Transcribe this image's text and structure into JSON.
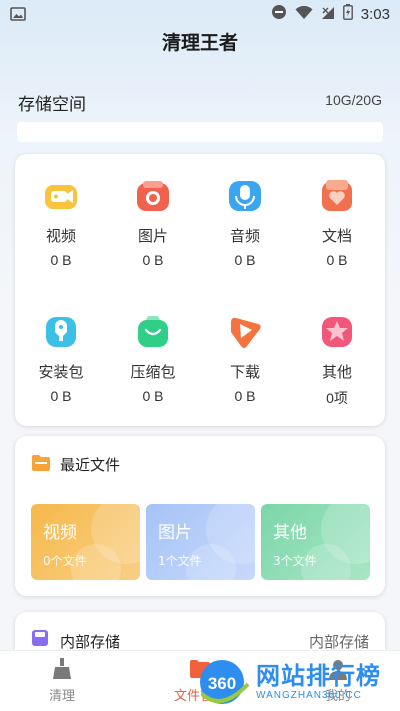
{
  "status_bar": {
    "time": "3:03"
  },
  "app": {
    "title": "清理王者"
  },
  "storage": {
    "label": "存储空间",
    "value": "10G/20G",
    "used_fraction": 0.0
  },
  "categories": [
    {
      "label": "视频",
      "count": "0 B",
      "icon": "video-icon",
      "color": "#f7c43c"
    },
    {
      "label": "图片",
      "count": "0 B",
      "icon": "camera-icon",
      "color": "#f0624e"
    },
    {
      "label": "音频",
      "count": "0 B",
      "icon": "microphone-icon",
      "color": "#3aa6f2"
    },
    {
      "label": "文档",
      "count": "0 B",
      "icon": "document-heart-icon",
      "color": "#f2704f"
    },
    {
      "label": "安装包",
      "count": "0 B",
      "icon": "package-icon",
      "color": "#3cc0e6"
    },
    {
      "label": "压缩包",
      "count": "0 B",
      "icon": "archive-bag-icon",
      "color": "#2fcf86"
    },
    {
      "label": "下载",
      "count": "0 B",
      "icon": "download-icon",
      "color": "#f5733f"
    },
    {
      "label": "其他",
      "count": "0项",
      "icon": "star-icon",
      "color": "#f2577a"
    }
  ],
  "recent": {
    "title": "最近文件",
    "tiles": [
      {
        "name": "视频",
        "count": "0个文件",
        "color_from": "#f6b94a",
        "color_to": "#f9cf86"
      },
      {
        "name": "图片",
        "count": "1个文件",
        "color_from": "#a6c3f7",
        "color_to": "#c7d9fb"
      },
      {
        "name": "其他",
        "count": "3个文件",
        "color_from": "#7bd6a8",
        "color_to": "#a9e6c6"
      }
    ]
  },
  "internal": {
    "title": "内部存储",
    "right_label": "内部存储"
  },
  "tabs": [
    {
      "label": "清理",
      "icon": "broom-icon",
      "active": false
    },
    {
      "label": "文件管理",
      "icon": "folder-icon",
      "active": true
    },
    {
      "label": "我的",
      "icon": "user-icon",
      "active": false
    }
  ],
  "watermark": {
    "badge": "360",
    "text": "网站排行榜",
    "sub": "WANGZHAN360.CC"
  }
}
